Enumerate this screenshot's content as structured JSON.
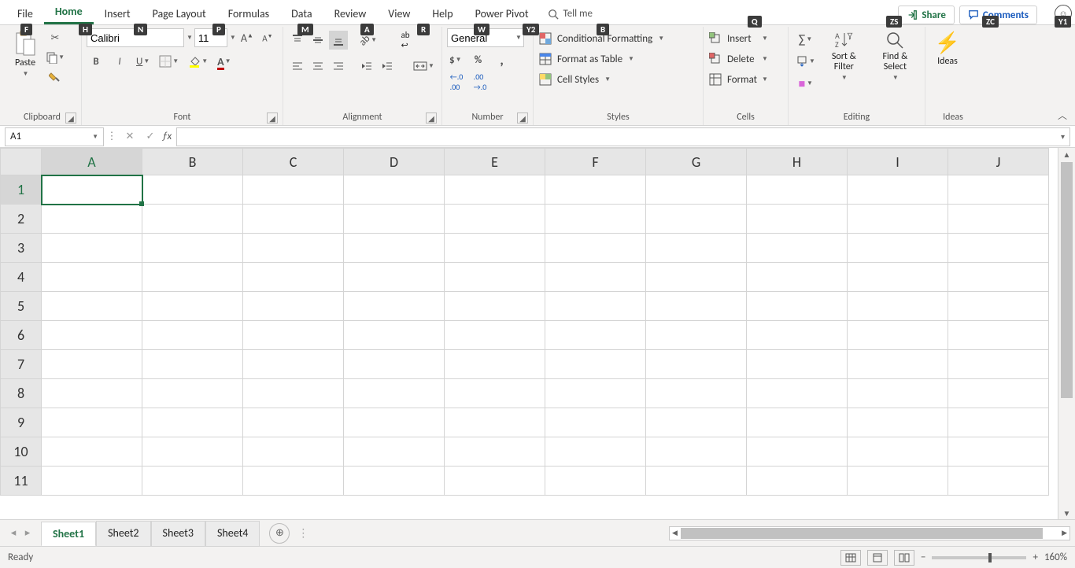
{
  "tabs": {
    "file": "File",
    "home": "Home",
    "insert": "Insert",
    "pagelayout": "Page Layout",
    "formulas": "Formulas",
    "data": "Data",
    "review": "Review",
    "view": "View",
    "help": "Help",
    "powerpivot": "Power Pivot",
    "tellme": "Tell me"
  },
  "keytips": {
    "file": "F",
    "home": "H",
    "insert": "N",
    "pagelayout": "P",
    "formulas": "M",
    "data": "A",
    "review": "R",
    "view": "W",
    "help": "Y2",
    "powerpivot": "B",
    "tellme": "Q",
    "share": "ZS",
    "comments": "ZC",
    "face": "Y1"
  },
  "actions": {
    "share": "Share",
    "comments": "Comments"
  },
  "ribbon": {
    "clipboard": {
      "paste": "Paste",
      "label": "Clipboard"
    },
    "font": {
      "name": "Calibri",
      "size": "11",
      "label": "Font"
    },
    "alignment": {
      "label": "Alignment"
    },
    "number": {
      "format": "General",
      "label": "Number"
    },
    "styles": {
      "cf": "Conditional Formatting",
      "fat": "Format as Table",
      "cs": "Cell Styles",
      "label": "Styles"
    },
    "cells": {
      "insert": "Insert",
      "delete": "Delete",
      "format": "Format",
      "label": "Cells"
    },
    "editing": {
      "sortfilter": "Sort & Filter",
      "findselect": "Find & Select",
      "label": "Editing"
    },
    "ideas": {
      "ideas": "Ideas",
      "label": "Ideas"
    }
  },
  "namebox": "A1",
  "columns": [
    "A",
    "B",
    "C",
    "D",
    "E",
    "F",
    "G",
    "H",
    "I",
    "J"
  ],
  "rows": [
    "1",
    "2",
    "3",
    "4",
    "5",
    "6",
    "7",
    "8",
    "9",
    "10",
    "11"
  ],
  "sheets": [
    "Sheet1",
    "Sheet2",
    "Sheet3",
    "Sheet4"
  ],
  "status": {
    "ready": "Ready",
    "zoom": "160%"
  }
}
